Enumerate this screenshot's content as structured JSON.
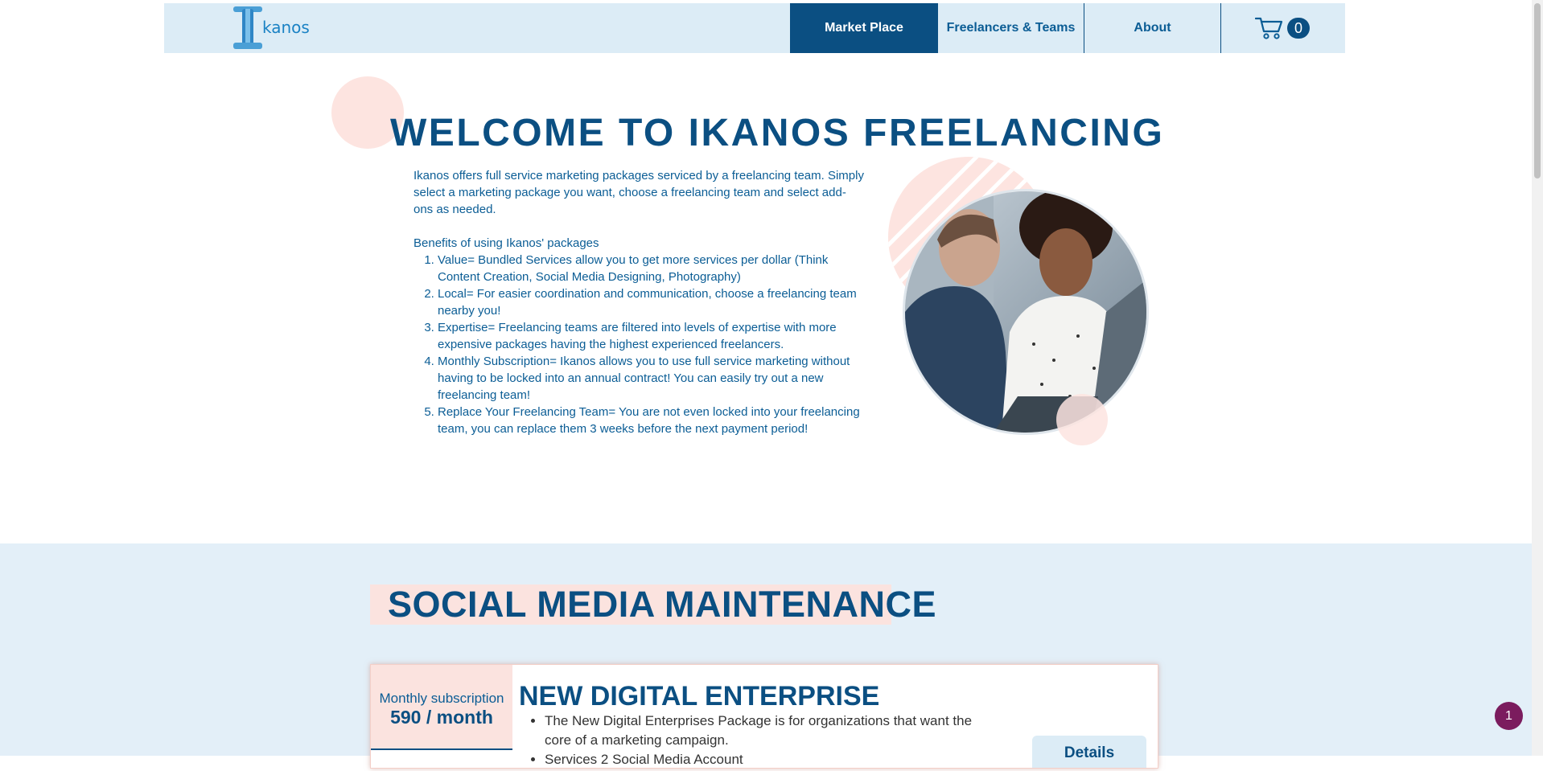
{
  "header": {
    "logo_text": "kanos",
    "nav": [
      {
        "label": "Market Place",
        "active": true
      },
      {
        "label": "Freelancers & Teams",
        "active": false
      },
      {
        "label": "About",
        "active": false
      }
    ],
    "cart_count": "0"
  },
  "hero": {
    "title": "WELCOME TO IKANOS FREELANCING",
    "intro": "Ikanos offers full service marketing packages serviced by a freelancing team. Simply select a marketing package you want,  choose a freelancing team and select add-ons as needed.",
    "benefits_title": "Benefits of using Ikanos' packages",
    "benefits": [
      "Value= Bundled Services allow you to get more services per dollar (Think Content Creation, Social Media Designing, Photography)",
      "Local= For easier coordination and communication, choose a freelancing team nearby you!",
      "Expertise= Freelancing teams are filtered into levels of expertise with more expensive packages having the highest experienced freelancers.",
      "Monthly Subscription= Ikanos allows you to use full service marketing without having to be locked into an annual contract! You can easily try out a new freelancing team!",
      "Replace Your Freelancing Team= You are not even locked into your freelancing team, you can replace them 3 weeks before the next payment period!"
    ]
  },
  "section": {
    "title": "SOCIAL MEDIA MAINTENANCE",
    "card": {
      "price_label": "Monthly subscription",
      "price_value": "590 / month",
      "title": "NEW DIGITAL ENTERPRISE",
      "bullets": [
        "The New Digital Enterprises Package is for organizations that want the core of a marketing campaign.",
        "Services 2 Social Media Account"
      ],
      "details_label": "Details"
    }
  },
  "chat_badge": "1",
  "colors": {
    "primary": "#0b4f82",
    "header_bg": "#dcecf6",
    "section_bg": "#e3eff8",
    "accent_pink": "#fde4e0",
    "chat_badge": "#7b1c5e"
  }
}
